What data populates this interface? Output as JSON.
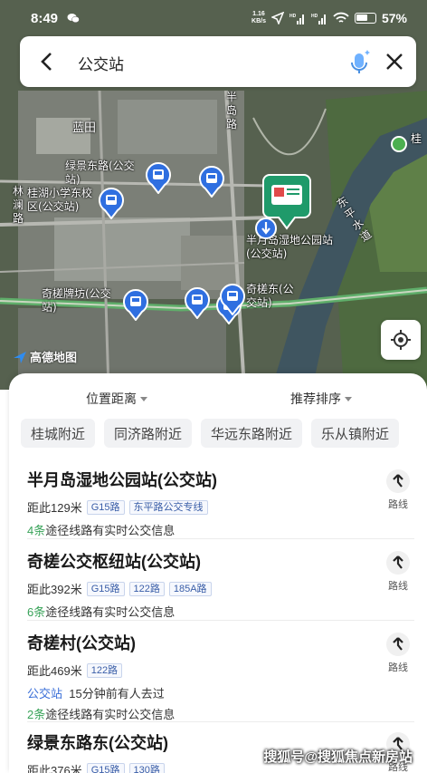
{
  "status": {
    "time": "8:49",
    "speed_top": "1.16",
    "speed_bottom": "KB/s",
    "battery": "57%"
  },
  "search": {
    "query": "公交站"
  },
  "map": {
    "labels": {
      "banyuedao_road": "半岛路",
      "lantian": "蓝田",
      "guilv": "桂",
      "lvjing_station": "绿景东路(公交站)",
      "xiaoxue": "桂湖小学东校区(公交站)",
      "lin_road": "林澜路",
      "dongping_river": "东平水道",
      "wetland_station": "半月岛湿地公园站(公交站)",
      "qicha_hub": "奇槎牌坊(公交站)",
      "qicha_east": "奇槎东(公交站)"
    },
    "brand": "高德地图"
  },
  "sheet": {
    "sort_distance": "位置距离",
    "sort_recommend": "推荐排序",
    "chips": [
      "桂城附近",
      "同济路附近",
      "华远东路附近",
      "乐从镇附近"
    ],
    "route_label": "路线",
    "items": [
      {
        "name": "半月岛湿地公园站(公交站)",
        "distance": "距此129米",
        "tags": [
          "G15路",
          "东平路公交专线"
        ],
        "count": "4条",
        "info": "途径线路有实时公交信息"
      },
      {
        "name": "奇槎公交枢纽站(公交站)",
        "distance": "距此392米",
        "tags": [
          "G15路",
          "122路",
          "185A路"
        ],
        "count": "6条",
        "info": "途径线路有实时公交信息"
      },
      {
        "name": "奇槎村(公交站)",
        "distance": "距此469米",
        "tags": [
          "122路"
        ],
        "extra_label": "公交站",
        "extra": "15分钟前有人去过",
        "count": "2条",
        "info": "途径线路有实时公交信息"
      },
      {
        "name": "绿景东路东(公交站)",
        "distance": "距此376米",
        "tags": [
          "G15路",
          "130路"
        ]
      }
    ]
  },
  "watermark": "搜狐号@搜狐焦点新房站"
}
